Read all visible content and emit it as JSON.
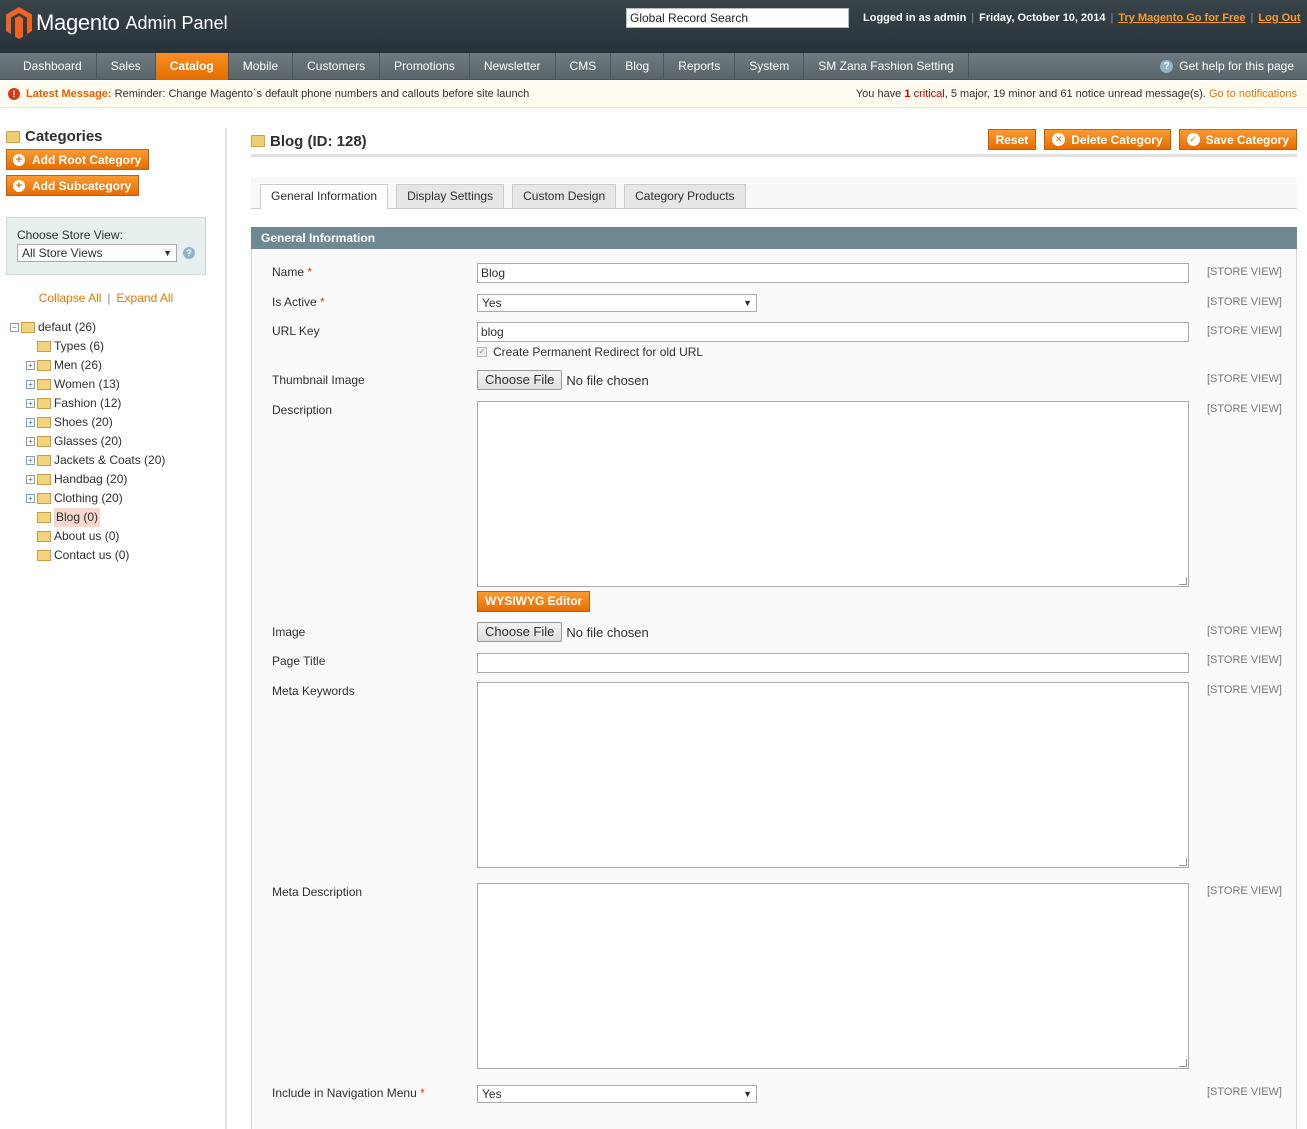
{
  "header": {
    "brand": "Magento",
    "sub": "Admin Panel",
    "search_placeholder": "Global Record Search",
    "logged_in": "Logged in as admin",
    "date": "Friday, October 10, 2014",
    "try_link": "Try Magento Go for Free",
    "logout": "Log Out"
  },
  "nav": {
    "items": [
      "Dashboard",
      "Sales",
      "Catalog",
      "Mobile",
      "Customers",
      "Promotions",
      "Newsletter",
      "CMS",
      "Blog",
      "Reports",
      "System",
      "SM Zana Fashion Setting"
    ],
    "active": "Catalog",
    "help": "Get help for this page"
  },
  "message": {
    "label": "Latest Message:",
    "text": "Reminder: Change Magento`s default phone numbers and callouts before site launch",
    "summary_pre": "You have",
    "critical_count": "1",
    "critical_label": "critical",
    "major": "5 major,",
    "minor": "19 minor and",
    "notice": "61 notice unread message(s).",
    "link": "Go to notifications"
  },
  "sidebar": {
    "title": "Categories",
    "add_root": "Add Root Category",
    "add_sub": "Add Subcategory",
    "store_label": "Choose Store View:",
    "store_value": "All Store Views",
    "collapse": "Collapse All",
    "expand": "Expand All",
    "tree": [
      {
        "label": "defaut (26)",
        "level": 0,
        "toggle": "-"
      },
      {
        "label": "Types (6)",
        "level": 1,
        "toggle": ""
      },
      {
        "label": "Men (26)",
        "level": 1,
        "toggle": "+"
      },
      {
        "label": "Women (13)",
        "level": 1,
        "toggle": "+"
      },
      {
        "label": "Fashion (12)",
        "level": 1,
        "toggle": "+"
      },
      {
        "label": "Shoes (20)",
        "level": 1,
        "toggle": "+"
      },
      {
        "label": "Glasses (20)",
        "level": 1,
        "toggle": "+"
      },
      {
        "label": "Jackets & Coats (20)",
        "level": 1,
        "toggle": "+"
      },
      {
        "label": "Handbag (20)",
        "level": 1,
        "toggle": "+"
      },
      {
        "label": "Clothing (20)",
        "level": 1,
        "toggle": "+"
      },
      {
        "label": "Blog (0)",
        "level": 1,
        "toggle": "",
        "selected": true
      },
      {
        "label": "About us (0)",
        "level": 1,
        "toggle": ""
      },
      {
        "label": "Contact us (0)",
        "level": 1,
        "toggle": ""
      }
    ]
  },
  "main": {
    "title": "Blog (ID: 128)",
    "reset": "Reset",
    "delete": "Delete Category",
    "save": "Save Category",
    "tabs": [
      "General Information",
      "Display Settings",
      "Custom Design",
      "Category Products"
    ],
    "fieldset_title": "General Information",
    "scope": "[STORE VIEW]",
    "fields": {
      "name_label": "Name",
      "name_value": "Blog",
      "active_label": "Is Active",
      "active_value": "Yes",
      "url_label": "URL Key",
      "url_value": "blog",
      "redirect_label": "Create Permanent Redirect for old URL",
      "thumb_label": "Thumbnail Image",
      "choose_file": "Choose File",
      "no_file": "No file chosen",
      "desc_label": "Description",
      "wysiwyg": "WYSIWYG Editor",
      "image_label": "Image",
      "page_title_label": "Page Title",
      "meta_kw_label": "Meta Keywords",
      "meta_desc_label": "Meta Description",
      "nav_label": "Include in Navigation Menu",
      "nav_value": "Yes",
      "required_mark": "*"
    }
  },
  "colors": {
    "accent": "#e76d00",
    "header": "#2f3a41",
    "fieldset_head": "#6f8992"
  }
}
